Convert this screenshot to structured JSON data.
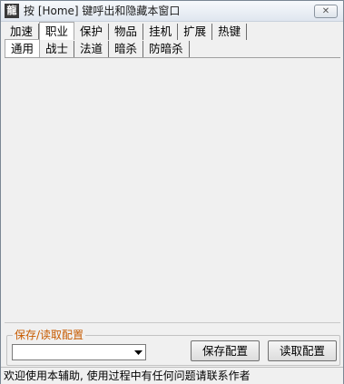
{
  "window": {
    "icon_label": "龍",
    "title": "按 [Home] 键呼出和隐藏本窗口",
    "close_label": "✕"
  },
  "tabs_row1": [
    {
      "label": "加速"
    },
    {
      "label": "职业",
      "active": true
    },
    {
      "label": "保护"
    },
    {
      "label": "物品"
    },
    {
      "label": "挂机"
    },
    {
      "label": "扩展"
    },
    {
      "label": "热键"
    }
  ],
  "tabs_row2": [
    {
      "label": "通用",
      "active": true
    },
    {
      "label": "战士"
    },
    {
      "label": "法道"
    },
    {
      "label": "暗杀"
    },
    {
      "label": "防暗杀"
    }
  ],
  "config": {
    "legend": "保存/读取配置",
    "combo_value": "",
    "save_label": "保存配置",
    "load_label": "读取配置"
  },
  "status": {
    "text": "欢迎使用本辅助, 使用过程中有任何问题请联系作者"
  }
}
